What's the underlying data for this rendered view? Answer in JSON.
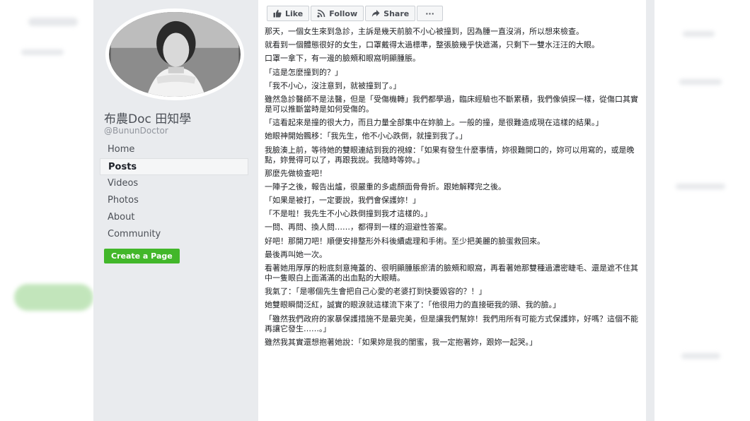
{
  "page": {
    "name": "布農Doc 田知學",
    "handle": "@BununDoctor"
  },
  "nav": [
    {
      "label": "Home",
      "active": false
    },
    {
      "label": "Posts",
      "active": true
    },
    {
      "label": "Videos",
      "active": false
    },
    {
      "label": "Photos",
      "active": false
    },
    {
      "label": "About",
      "active": false
    },
    {
      "label": "Community",
      "active": false
    }
  ],
  "create_page_label": "Create a Page",
  "actions": {
    "like": "Like",
    "follow": "Follow",
    "share": "Share",
    "more": "···"
  },
  "post_paragraphs": [
    "那天，一個女生來到急診，主訴是幾天前臉不小心被撞到，因為腫一直沒消，所以想來檢查。",
    "就看到一個體態很好的女生，口罩戴得太過標準，整張臉幾乎快遮滿，只剩下一雙水汪汪的大眼。",
    "口罩一拿下，有一邊的臉頰和眼窩明顯腫脹。",
    "「這是怎麼撞到的？」",
    "「我不小心，沒注意到，就被撞到了。」",
    "雖然急診醫師不是法醫，但是「受傷機轉」我們都學過，臨床經驗也不斷累積，我們像偵探一樣，從傷口其實是可以推斷當時是如何受傷的。",
    "「這看起來是撞的很大力，而且力量全部集中在妳臉上。一般的撞，是很難造成現在這樣的結果。」",
    "她眼神開始飄移：「我先生，他不小心跌倒，就撞到我了。」",
    "我臉湊上前，等待她的雙眼連結到我的視線：「如果有發生什麼事情，妳很難開口的，妳可以用寫的，或是晚點，妳覺得可以了，再跟我說。我隨時等妳。」",
    "那麼先做檢查吧！",
    "一陣子之後，報告出爐，很嚴重的多處顏面骨骨折。跟她解釋完之後。",
    "「如果是被打，一定要說，我們會保護妳！」",
    "「不是啦！我先生不小心跌倒撞到我才這樣的。」",
    "一問、再問、換人問……，都得到一樣的迴避性答案。",
    "好吧！那開刀吧！順便安排整形外科後續處理和手術。至少把美麗的臉蛋救回來。",
    "最後再叫她一次。",
    "看著她用厚厚的粉底刻意掩蓋的、很明顯腫脹瘀清的臉頰和眼窩，再看著她那雙種過濃密睫毛、還是遮不住其中一隻眼白上面滿滿的出血點的大眼睛。",
    "我氣了：「是哪個先生會把自己心愛的老婆打到快要毀容的？！」",
    "她雙眼瞬間泛紅，誠實的眼淚就這樣流下來了：「他很用力的直接砸我的頭、我的臉。」",
    "「雖然我們政府的家暴保護措施不是最完美，但是讓我們幫妳！我們用所有可能方式保護妳，好嗎？這個不能再讓它發生……。」",
    "雖然我其實還想抱著她說：「如果妳是我的閨蜜，我一定抱著妳，跟妳一起哭。」"
  ]
}
